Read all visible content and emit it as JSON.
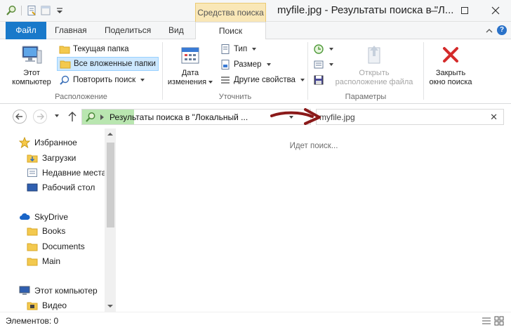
{
  "titlebar": {
    "context_tab_label": "Средства поиска",
    "window_title": "myfile.jpg - Результаты поиска в \"Л..."
  },
  "tabs": [
    {
      "label": "Файл"
    },
    {
      "label": "Главная"
    },
    {
      "label": "Поделиться"
    },
    {
      "label": "Вид"
    },
    {
      "label": "Поиск"
    }
  ],
  "ribbon": {
    "location": {
      "group_label": "Расположение",
      "this_pc_label": "Этот\nкомпьютер",
      "current_folder_label": "Текущая папка",
      "all_subfolders_label": "Все вложенные папки",
      "search_again_label": "Повторить поиск"
    },
    "refine": {
      "group_label": "Уточнить",
      "date_modified_label": "Дата\nизменения",
      "type_label": "Тип",
      "size_label": "Размер",
      "other_props_label": "Другие свойства"
    },
    "options": {
      "group_label": "Параметры",
      "open_location_label": "Открыть\nрасположение файла"
    },
    "close": {
      "close_search_label": "Закрыть\nокно поиска"
    }
  },
  "address": {
    "path_text": "Результаты поиска в \"Локальный ...",
    "search_value": "myfile.jpg"
  },
  "navpane": {
    "favorites": "Избранное",
    "downloads": "Загрузки",
    "recent": "Недавние места",
    "desktop": "Рабочий стол",
    "skydrive": "SkyDrive",
    "books": "Books",
    "documents": "Documents",
    "main": "Main",
    "this_pc": "Этот компьютер",
    "video": "Видео"
  },
  "content": {
    "status_message": "Идет поиск..."
  },
  "statusbar": {
    "items_text": "Элементов: 0"
  },
  "colors": {
    "file_tab": "#1979ca",
    "context_tab": "#f9e7b7",
    "selected_button": "#cde8ff",
    "address_progress": "#b9e6b0",
    "annotation_arrow": "#8b1a1a"
  }
}
